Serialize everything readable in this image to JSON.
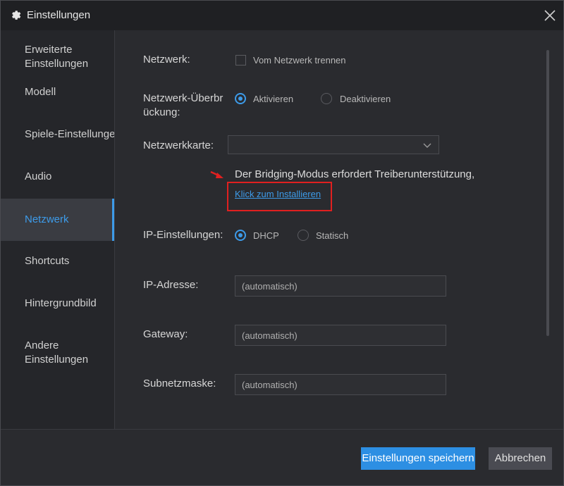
{
  "window": {
    "title": "Einstellungen",
    "icon": "gear-icon",
    "close_icon": "close-icon"
  },
  "sidebar": {
    "items": [
      {
        "label": "Erweiterte Einstellungen",
        "lines": [
          "Erweiterte",
          "Einstellungen"
        ],
        "active": false
      },
      {
        "label": "Modell",
        "active": false
      },
      {
        "label": "Spiele-Einstellungen",
        "active": false
      },
      {
        "label": "Audio",
        "active": false
      },
      {
        "label": "Netzwerk",
        "active": true
      },
      {
        "label": "Shortcuts",
        "active": false
      },
      {
        "label": "Hintergrundbild",
        "active": false
      },
      {
        "label": "Andere Einstellungen",
        "lines": [
          "Andere",
          "Einstellungen"
        ],
        "active": false
      }
    ]
  },
  "network": {
    "label": "Netzwerk:",
    "disconnect_label": "Vom Netzwerk trennen",
    "disconnect_checked": false
  },
  "bridging": {
    "label_line1": "Netzwerk-Überbr",
    "label_line2": "ückung:",
    "enable_label": "Aktivieren",
    "disable_label": "Deaktivieren",
    "selected": "Aktivieren"
  },
  "network_card": {
    "label": "Netzwerkkarte:",
    "value": ""
  },
  "notice": {
    "text": "Der Bridging-Modus erfordert Treiberunterstützung,",
    "link": "Klick zum Installieren",
    "highlight_color": "#e02020"
  },
  "ip_settings": {
    "label": "IP-Einstellungen:",
    "dhcp_label": "DHCP",
    "static_label": "Statisch",
    "selected": "DHCP"
  },
  "fields": {
    "ip_label": "IP-Adresse:",
    "ip_placeholder": "(automatisch)",
    "gateway_label": "Gateway:",
    "gateway_placeholder": "(automatisch)",
    "subnet_label": "Subnetzmaske:",
    "subnet_placeholder": "(automatisch)"
  },
  "footer": {
    "save_label": "Einstellungen speichern",
    "cancel_label": "Abbrechen"
  },
  "colors": {
    "accent": "#3d9be9",
    "save_button": "#2d8fe3",
    "background": "#2a2b2f"
  }
}
